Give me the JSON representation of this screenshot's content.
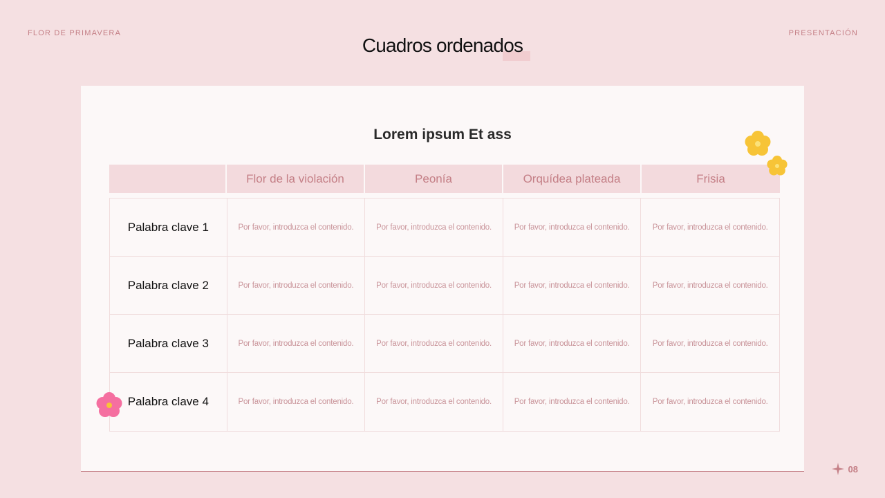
{
  "header": {
    "left_label": "FLOR DE PRIMAVERA",
    "right_label": "PRESENTACIÓN",
    "title": "Cuadros ordenados"
  },
  "table": {
    "heading": "Lorem ipsum Et ass",
    "columns": [
      "",
      "Flor de la violación",
      "Peonía",
      "Orquídea plateada",
      "Frisia"
    ],
    "rows": [
      {
        "label": "Palabra clave 1",
        "cells": [
          "Por favor, introduzca el contenido.",
          "Por favor, introduzca el contenido.",
          "Por favor, introduzca el contenido.",
          "Por favor, introduzca el contenido."
        ]
      },
      {
        "label": "Palabra clave 2",
        "cells": [
          "Por favor, introduzca el contenido.",
          "Por favor, introduzca el contenido.",
          "Por favor, introduzca el contenido.",
          "Por favor, introduzca el contenido."
        ]
      },
      {
        "label": "Palabra clave 3",
        "cells": [
          "Por favor, introduzca el contenido.",
          "Por favor, introduzca el contenido.",
          "Por favor, introduzca el contenido.",
          "Por favor, introduzca el contenido."
        ]
      },
      {
        "label": "Palabra clave 4",
        "cells": [
          "Por favor, introduzca el contenido.",
          "Por favor, introduzca el contenido.",
          "Por favor, introduzca el contenido.",
          "Por favor, introduzca el contenido."
        ]
      }
    ]
  },
  "footer": {
    "page_number": "08",
    "icon": "sparkle-icon"
  },
  "decorations": {
    "yellow_flower_icon": "yellow-flower-icon",
    "pink_flower_icon": "pink-flower-icon"
  },
  "colors": {
    "background": "#f5e0e2",
    "accent": "#c47f86",
    "card": "#fcf8f8",
    "header_fill": "#f3dadd",
    "flower_yellow": "#f7c437",
    "flower_pink": "#f56fa0"
  }
}
